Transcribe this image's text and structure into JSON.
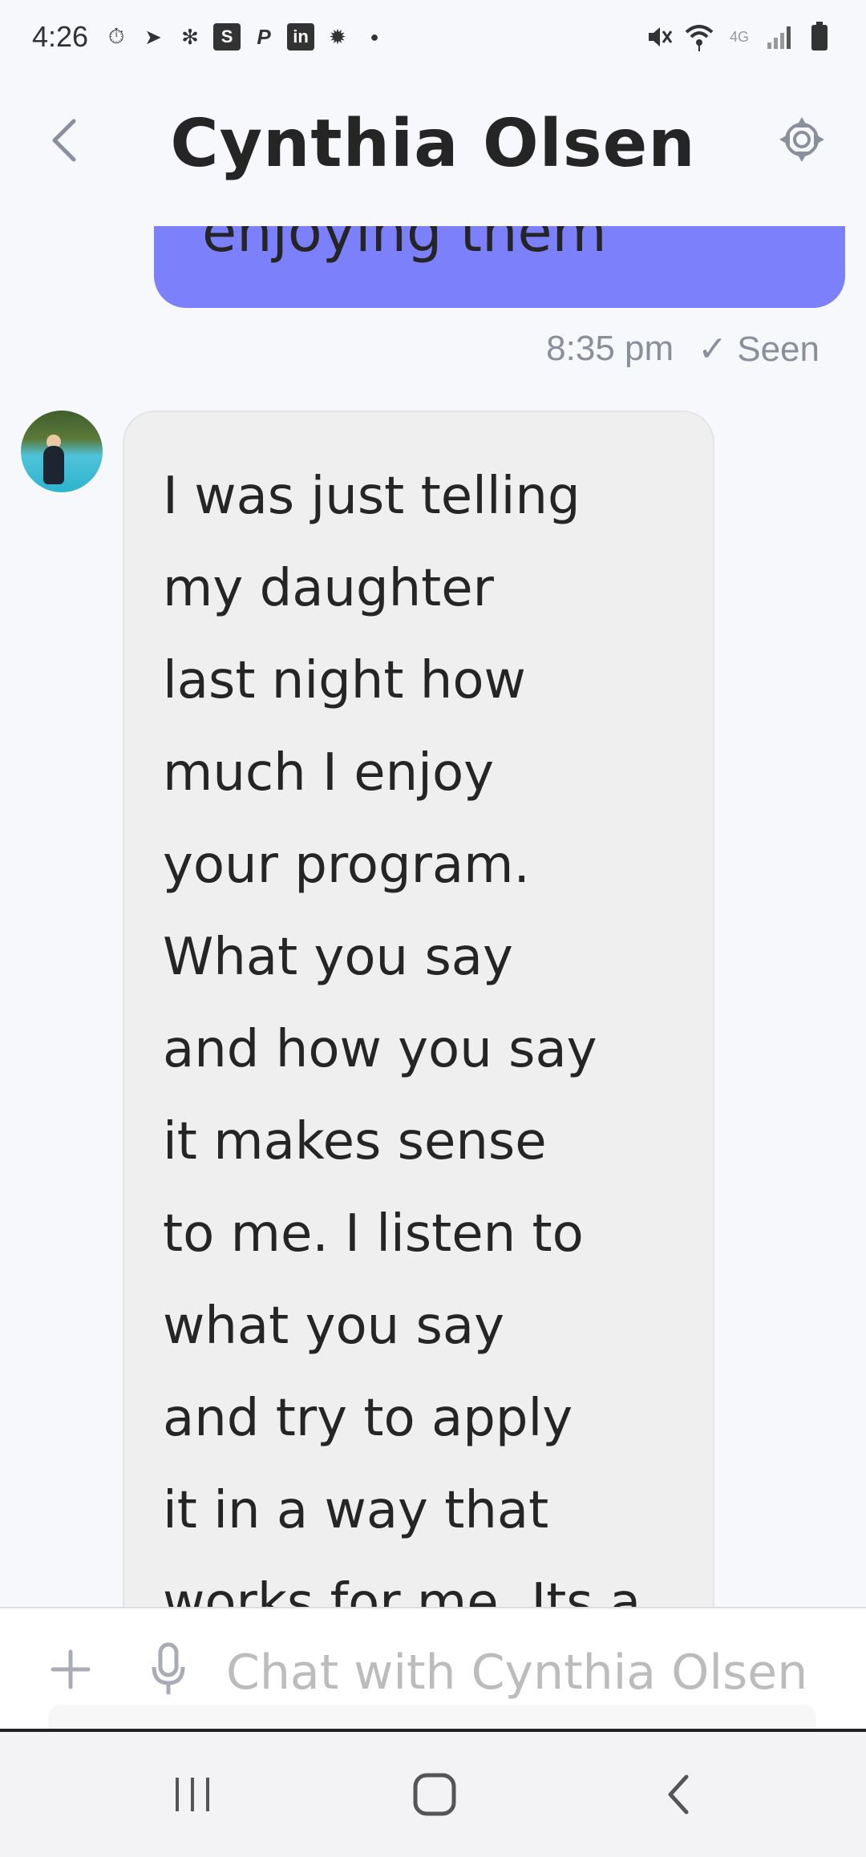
{
  "status_bar": {
    "time": "4:26",
    "left_icons": [
      "timer-icon",
      "navigation-icon",
      "pinwheel-icon",
      "skype-icon",
      "paypal-icon",
      "linkedin-icon",
      "sun-icon",
      "dot-icon"
    ],
    "right_icons": [
      "mute-icon",
      "wifi-icon",
      "lte-icon",
      "signal-icon",
      "battery-icon"
    ]
  },
  "header": {
    "title": "Cynthia Olsen",
    "back_icon": "chevron-left-icon",
    "settings_icon": "gear-icon"
  },
  "messages": {
    "sent_partial_text": "enjoying them",
    "sent_time": "8:35 pm",
    "sent_status": "✓ Seen",
    "received_text": "I was just telling\nmy daughter\nlast night how\nmuch I enjoy\nyour program.\nWhat you say\nand how you say\nit makes sense\nto me. I listen to\nwhat you say\nand try to apply\nit in a way that\nworks for me. Its a"
  },
  "composer": {
    "placeholder": "Chat with Cynthia Olsen",
    "plus_icon": "plus-icon",
    "mic_icon": "microphone-icon"
  },
  "nav": {
    "recents_icon": "recents-icon",
    "home_icon": "home-icon",
    "back_icon": "back-icon"
  },
  "colors": {
    "sent_bubble": "#7c80fb",
    "received_bubble": "#efeff0",
    "background": "#f7f8fc",
    "muted_text": "#8a8f9c"
  }
}
